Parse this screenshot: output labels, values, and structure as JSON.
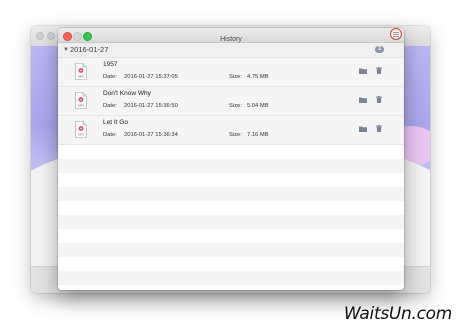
{
  "window": {
    "title": "History"
  },
  "group": {
    "date": "2016-01-27",
    "count": "3"
  },
  "labels": {
    "date": "Date:",
    "size": "Size:"
  },
  "icons": {
    "menu": "hamburger-menu-icon",
    "file": "mp3-file-icon",
    "folder": "folder-icon",
    "trash": "trash-icon",
    "caret": "disclosure-triangle-icon"
  },
  "colors": {
    "menu_ring": "#d2452b",
    "close": "#fc5f57",
    "maximize": "#34c748",
    "badge": "#8d93a6",
    "background_accent": "#a9a6ec"
  },
  "items": [
    {
      "name": "1957",
      "date": "2016-01-27 15:37:05",
      "size": "4.75 MB"
    },
    {
      "name": "Don't Know Why",
      "date": "2016-01-27 15:36:50",
      "size": "5.04 MB"
    },
    {
      "name": "Let It Go",
      "date": "2016-01-27 15:36:34",
      "size": "7.16 MB"
    }
  ],
  "file_icon_text": "MP3",
  "watermark": "WaitsUn.com"
}
